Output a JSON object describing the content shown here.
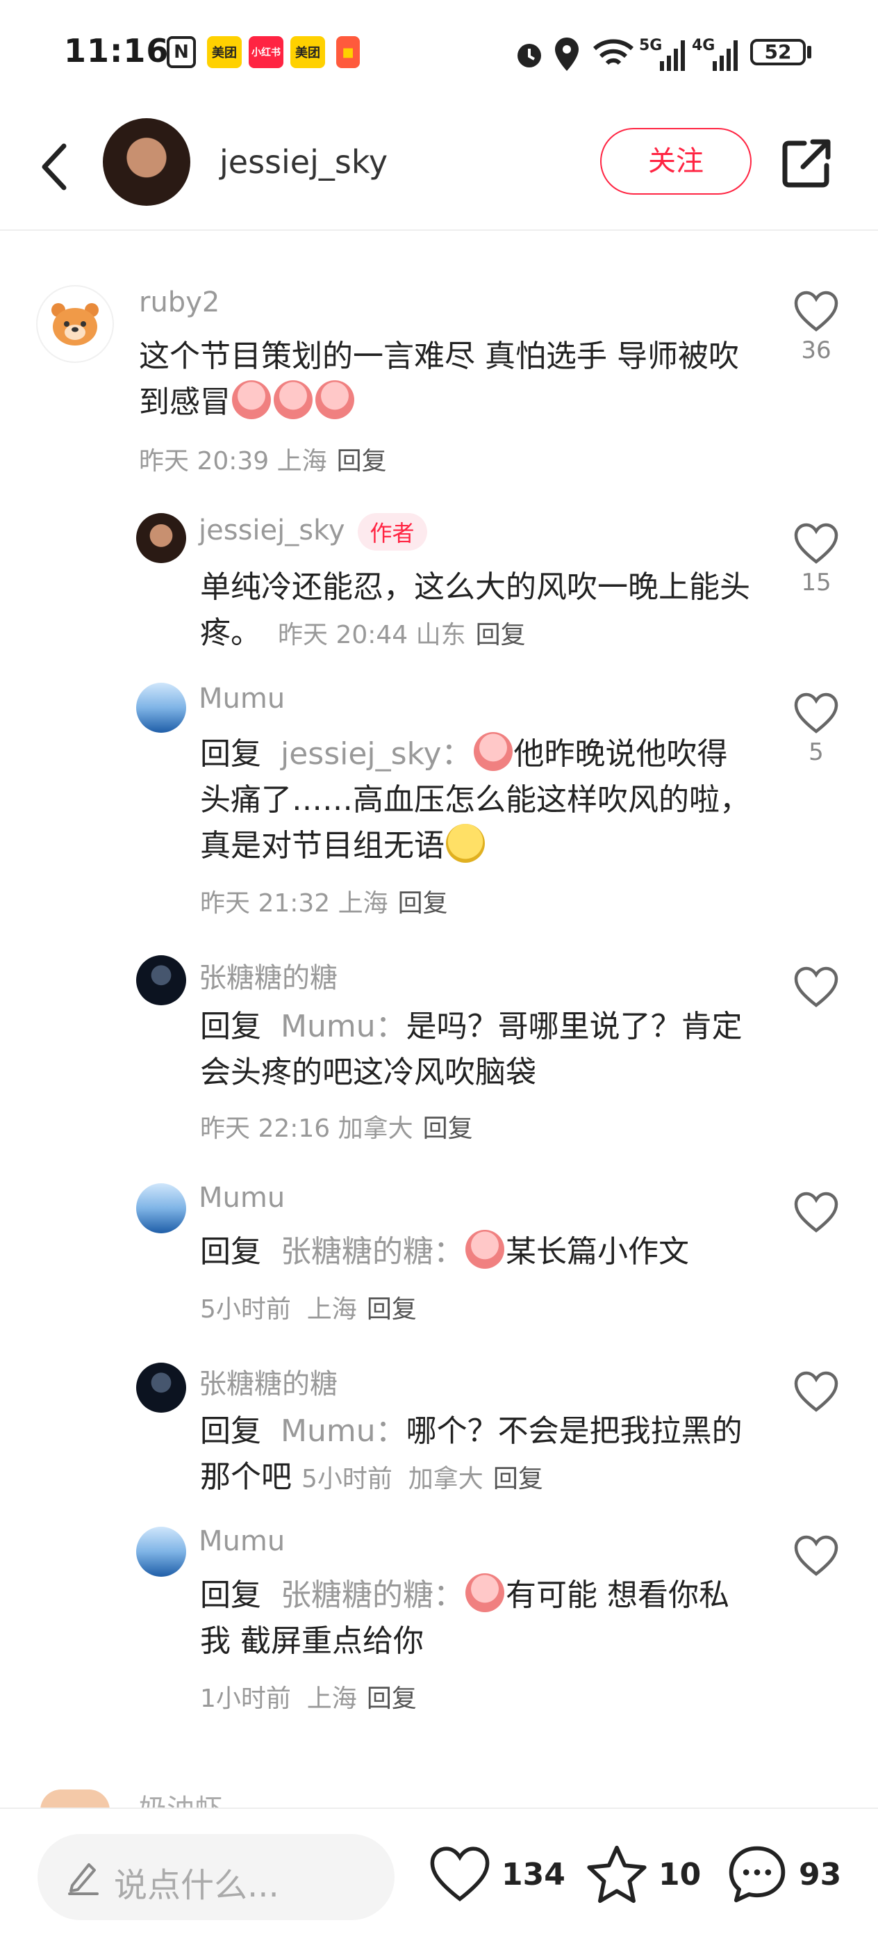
{
  "status_bar": {
    "time": "11:16",
    "battery": "52",
    "icons": [
      "nfc-icon",
      "meituan-app-icon",
      "xiaohongshu-app-icon",
      "meituan-app-icon",
      "redpacket-icon",
      "alarm-icon",
      "location-icon",
      "wifi-icon",
      "5g-signal-icon",
      "4g-signal-icon",
      "battery-icon"
    ],
    "app_labels": [
      "美团",
      "小红书",
      "美团"
    ]
  },
  "header": {
    "username": "jessiej_sky",
    "follow_label": "关注"
  },
  "comments": [
    {
      "name": "ruby2",
      "text": "这个节目策划的一言难尽 真怕选手 导师被吹到感冒",
      "time": "昨天 20:39",
      "location": "上海",
      "reply_label": "回复",
      "likes": "36"
    },
    {
      "name": "jessiej_sky",
      "badge": "作者",
      "text": "单纯冷还能忍，这么大的风吹一晚上能头疼。",
      "time": "昨天 20:44",
      "location": "山东",
      "reply_label": "回复",
      "likes": "15"
    },
    {
      "name": "Mumu",
      "reply_prefix": "回复",
      "reply_target": "jessiej_sky：",
      "text": "他昨晚说他吹得头痛了……高血压怎么能这样吹风的啦，真是对节目组无语",
      "time": "昨天 21:32",
      "location": "上海",
      "reply_label": "回复",
      "likes": "5"
    },
    {
      "name": "张糖糖的糖",
      "reply_prefix": "回复",
      "reply_target": "Mumu：",
      "text": "是吗？哥哪里说了？肯定会头疼的吧这冷风吹脑袋",
      "time": "昨天 22:16",
      "location": "加拿大",
      "reply_label": "回复",
      "likes": ""
    },
    {
      "name": "Mumu",
      "reply_prefix": "回复",
      "reply_target": "张糖糖的糖：",
      "text": "某长篇小作文",
      "time": "5小时前",
      "location": "上海",
      "reply_label": "回复",
      "likes": ""
    },
    {
      "name": "张糖糖的糖",
      "reply_prefix": "回复",
      "reply_target": "Mumu：",
      "text": "哪个？不会是把我拉黑的那个吧",
      "time": "5小时前",
      "location": "加拿大",
      "reply_label": "回复",
      "likes": ""
    },
    {
      "name": "Mumu",
      "reply_prefix": "回复",
      "reply_target": "张糖糖的糖：",
      "text": "有可能 想看你私我 截屏重点给你",
      "time": "1小时前",
      "location": "上海",
      "reply_label": "回复",
      "likes": ""
    }
  ],
  "partial_next": {
    "name": "奶油虾"
  },
  "bottom_bar": {
    "input_placeholder": "说点什么...",
    "likes": "134",
    "stars": "10",
    "comments": "93"
  },
  "colors": {
    "accent": "#ff2442",
    "muted": "#999999"
  }
}
